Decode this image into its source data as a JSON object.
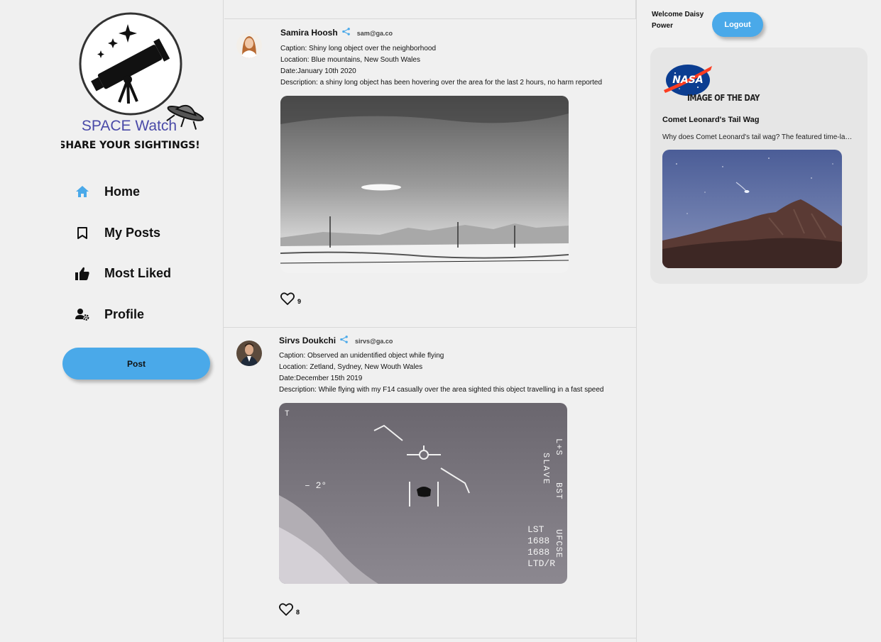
{
  "brand": {
    "name": "SPACE Watch",
    "tagline": "SHARE YOUR SIGHTINGS!"
  },
  "nav": {
    "items": [
      {
        "label": "Home",
        "icon": "home-icon"
      },
      {
        "label": "My Posts",
        "icon": "bookmark-icon"
      },
      {
        "label": "Most Liked",
        "icon": "thumbs-up-icon"
      },
      {
        "label": "Profile",
        "icon": "manage-account-icon"
      }
    ],
    "post_label": "Post"
  },
  "posts": [
    {
      "author": "Samira Hoosh",
      "email": "sam@ga.co",
      "caption": "Caption: Shiny long object over the neighborhood",
      "location": "Location: Blue mountains, New South Wales",
      "date": "Date:January 10th 2020",
      "description": "Description: a shiny long object has been hovering over the area for the last 2 hours, no harm reported",
      "likes": "9"
    },
    {
      "author": "Sirvs Doukchi",
      "email": "sirvs@ga.co",
      "caption": "Caption: Observed an unidentified object while flying",
      "location": "Location: Zetland, Sydney, New Wouth Wales",
      "date": "Date:December 15th 2019",
      "description": "Description: While flying with my F14 casually over the area sighted this object travelling in a fast speed",
      "likes": "8",
      "hud": {
        "left": "– 2°",
        "col1": "SLAVE",
        "col2": "L+S",
        "col3": "BST",
        "lines": [
          "LST",
          "1688",
          "1688",
          "LTD/R"
        ],
        "col4": "UFCSE"
      }
    }
  ],
  "header": {
    "welcome": "Welcome Daisy Power",
    "logout_label": "Logout"
  },
  "apod": {
    "logo_text": "NASA",
    "label": "IMAGE OF THE DAY",
    "title": "Comet Leonard's Tail Wag",
    "description": "Why does Comet Leonard's tail wag? The featured time-lapse video was recorded over several hours"
  },
  "colors": {
    "accent": "#4aa9e9",
    "brand_purple": "#4a4aa8",
    "nasa_blue": "#0b3d91",
    "nasa_red": "#fc3d21"
  }
}
